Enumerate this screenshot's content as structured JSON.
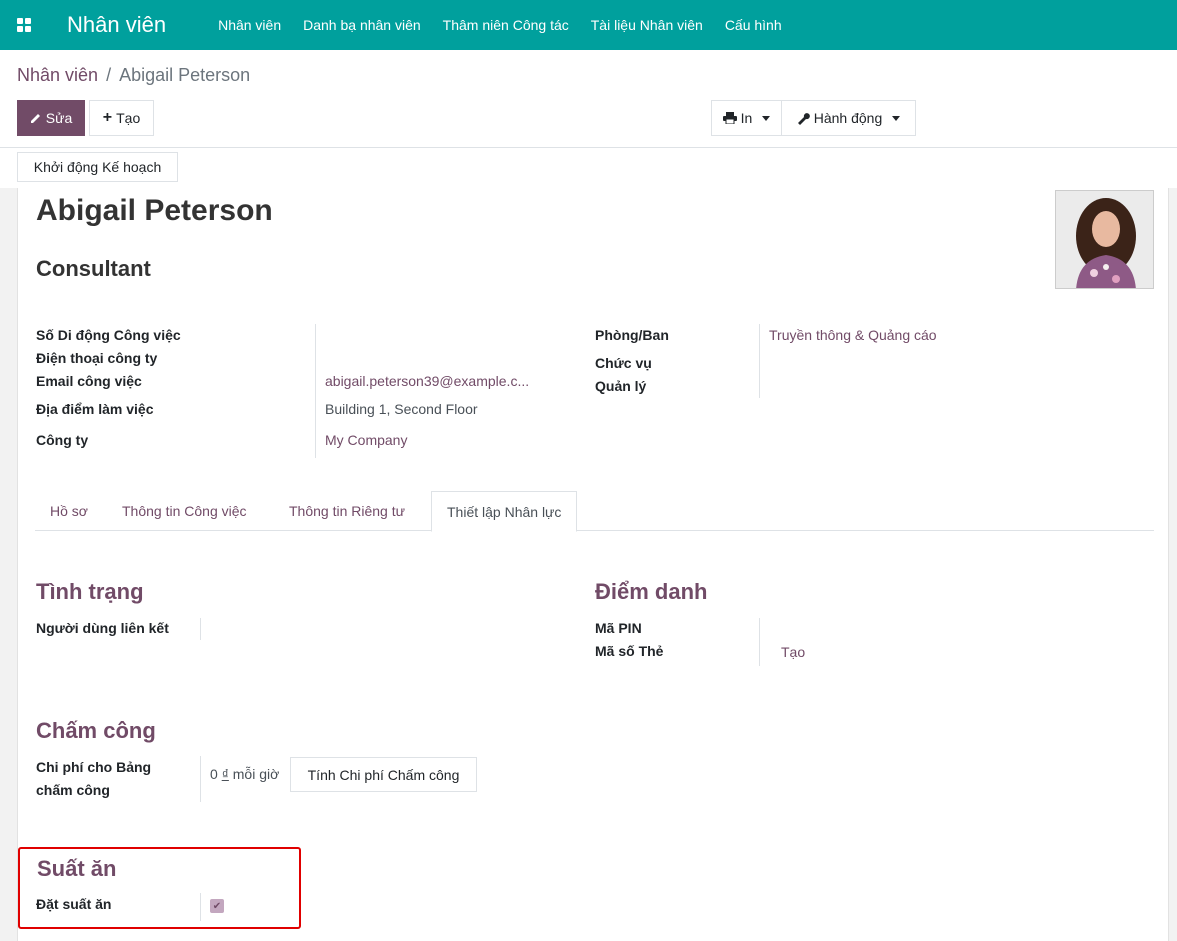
{
  "navbar": {
    "brand": "Nhân viên",
    "menu": [
      "Nhân viên",
      "Danh bạ nhân viên",
      "Thâm niên Công tác",
      "Tài liệu Nhân viên",
      "Cấu hình"
    ]
  },
  "breadcrumb": {
    "parent": "Nhân viên",
    "separator": "/",
    "current": "Abigail Peterson"
  },
  "toolbar": {
    "edit": "Sửa",
    "create": "Tạo",
    "print": "In",
    "action": "Hành động"
  },
  "statusbar": {
    "launch_plan": "Khởi động Kế hoạch"
  },
  "employee": {
    "name": "Abigail Peterson",
    "job_title": "Consultant"
  },
  "fields_left": {
    "mobile_label": "Số Di động Công việc",
    "phone_label": "Điện thoại công ty",
    "email_label": "Email công việc",
    "email_value": "abigail.peterson39@example.c...",
    "location_label": "Địa điểm làm việc",
    "location_value": "Building 1, Second Floor",
    "company_label": "Công ty",
    "company_value": "My Company"
  },
  "fields_right": {
    "department_label": "Phòng/Ban",
    "department_value": "Truyền thông & Quảng cáo",
    "job_label": "Chức vụ",
    "manager_label": "Quản lý"
  },
  "tabs": [
    "Hồ sơ",
    "Thông tin Công việc",
    "Thông tin Riêng tư",
    "Thiết lập Nhân lực"
  ],
  "status_section": {
    "title": "Tình trạng",
    "related_user_label": "Người dùng liên kết"
  },
  "attendance_section": {
    "title": "Điểm danh",
    "pin_label": "Mã PIN",
    "badge_label": "Mã số Thẻ",
    "badge_create": "Tạo"
  },
  "timesheet_section": {
    "title": "Chấm công",
    "cost_label_1": "Chi phí cho Bảng",
    "cost_label_2": "chấm công",
    "cost_value": "0",
    "currency": "₫",
    "per_hour": "mỗi giờ",
    "compute_button": "Tính Chi phí Chấm công"
  },
  "meal_section": {
    "title": "Suất ăn",
    "order_label": "Đặt suất ăn",
    "order_checked": true
  },
  "colors": {
    "navbar": "#00a09d",
    "brand_purple": "#714b67",
    "highlight": "#e00000"
  }
}
